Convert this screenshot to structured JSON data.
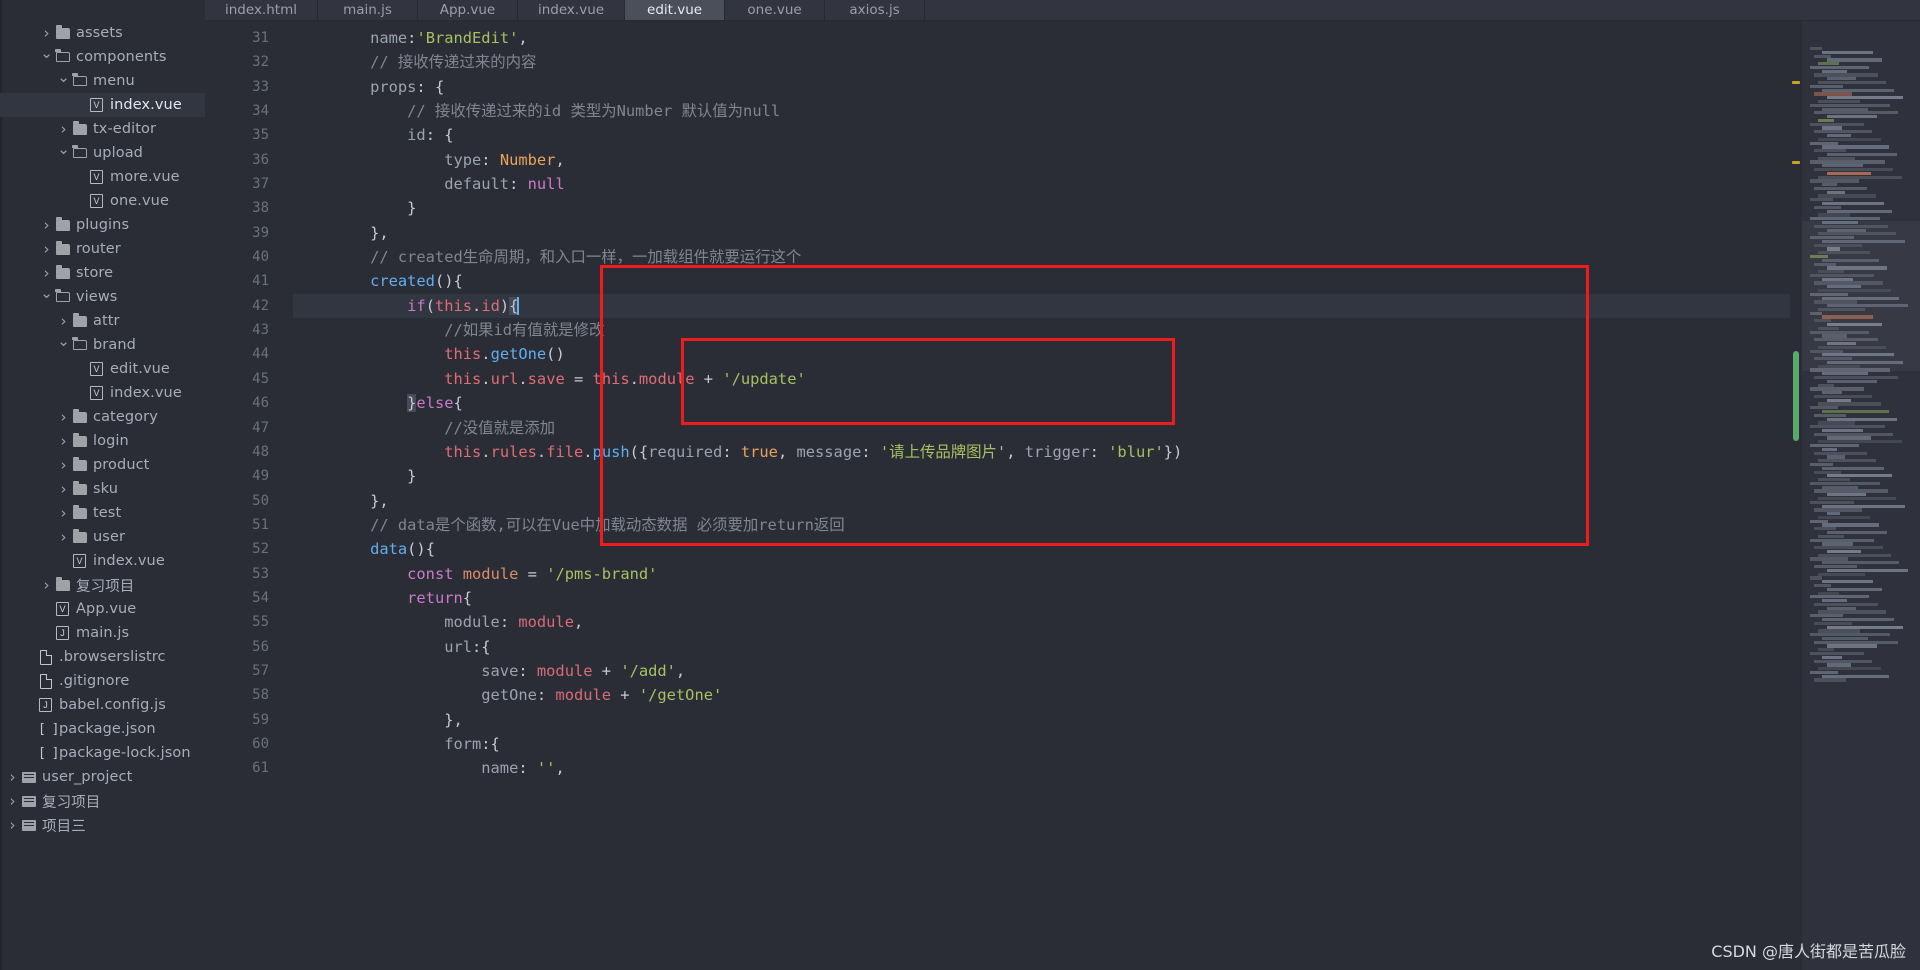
{
  "window": {
    "accent_red": "#f21b1b",
    "background": "#2b2d36",
    "watermark": "CSDN @唐人街都是苦瓜脸"
  },
  "tabs": [
    {
      "label": "index.html",
      "active": false
    },
    {
      "label": "main.js",
      "active": false
    },
    {
      "label": "App.vue",
      "active": false
    },
    {
      "label": "index.vue",
      "active": false
    },
    {
      "label": "edit.vue",
      "active": true
    },
    {
      "label": "one.vue",
      "active": false
    },
    {
      "label": "axios.js",
      "active": false
    }
  ],
  "sidebar": {
    "items": [
      {
        "label": "assets",
        "indent": 2,
        "arrow": "right",
        "icon": "folder-closed-icon",
        "selected": false
      },
      {
        "label": "components",
        "indent": 2,
        "arrow": "down",
        "icon": "folder-open-icon",
        "selected": false
      },
      {
        "label": "menu",
        "indent": 3,
        "arrow": "down",
        "icon": "folder-open-icon",
        "selected": false
      },
      {
        "label": "index.vue",
        "indent": 4,
        "arrow": "none",
        "icon": "vue-file-icon",
        "selected": true
      },
      {
        "label": "tx-editor",
        "indent": 3,
        "arrow": "right",
        "icon": "folder-closed-icon",
        "selected": false
      },
      {
        "label": "upload",
        "indent": 3,
        "arrow": "down",
        "icon": "folder-open-icon",
        "selected": false
      },
      {
        "label": "more.vue",
        "indent": 4,
        "arrow": "none",
        "icon": "vue-file-icon",
        "selected": false
      },
      {
        "label": "one.vue",
        "indent": 4,
        "arrow": "none",
        "icon": "vue-file-icon",
        "selected": false
      },
      {
        "label": "plugins",
        "indent": 2,
        "arrow": "right",
        "icon": "folder-closed-icon",
        "selected": false
      },
      {
        "label": "router",
        "indent": 2,
        "arrow": "right",
        "icon": "folder-closed-icon",
        "selected": false
      },
      {
        "label": "store",
        "indent": 2,
        "arrow": "right",
        "icon": "folder-closed-icon",
        "selected": false
      },
      {
        "label": "views",
        "indent": 2,
        "arrow": "down",
        "icon": "folder-open-icon",
        "selected": false
      },
      {
        "label": "attr",
        "indent": 3,
        "arrow": "right",
        "icon": "folder-closed-icon",
        "selected": false
      },
      {
        "label": "brand",
        "indent": 3,
        "arrow": "down",
        "icon": "folder-open-icon",
        "selected": false
      },
      {
        "label": "edit.vue",
        "indent": 4,
        "arrow": "none",
        "icon": "vue-file-icon",
        "selected": false
      },
      {
        "label": "index.vue",
        "indent": 4,
        "arrow": "none",
        "icon": "vue-file-icon",
        "selected": false
      },
      {
        "label": "category",
        "indent": 3,
        "arrow": "right",
        "icon": "folder-closed-icon",
        "selected": false
      },
      {
        "label": "login",
        "indent": 3,
        "arrow": "right",
        "icon": "folder-closed-icon",
        "selected": false
      },
      {
        "label": "product",
        "indent": 3,
        "arrow": "right",
        "icon": "folder-closed-icon",
        "selected": false
      },
      {
        "label": "sku",
        "indent": 3,
        "arrow": "right",
        "icon": "folder-closed-icon",
        "selected": false
      },
      {
        "label": "test",
        "indent": 3,
        "arrow": "right",
        "icon": "folder-closed-icon",
        "selected": false
      },
      {
        "label": "user",
        "indent": 3,
        "arrow": "right",
        "icon": "folder-closed-icon",
        "selected": false
      },
      {
        "label": "index.vue",
        "indent": 3,
        "arrow": "none",
        "icon": "vue-file-icon",
        "selected": false
      },
      {
        "label": "复习项目",
        "indent": 2,
        "arrow": "right",
        "icon": "folder-closed-icon",
        "selected": false
      },
      {
        "label": "App.vue",
        "indent": 2,
        "arrow": "none",
        "icon": "vue-file-icon",
        "selected": false
      },
      {
        "label": "main.js",
        "indent": 2,
        "arrow": "none",
        "icon": "js-file-icon",
        "selected": false
      },
      {
        "label": ".browserslistrc",
        "indent": 1,
        "arrow": "none",
        "icon": "file-icon",
        "selected": false
      },
      {
        "label": ".gitignore",
        "indent": 1,
        "arrow": "none",
        "icon": "file-icon",
        "selected": false
      },
      {
        "label": "babel.config.js",
        "indent": 1,
        "arrow": "none",
        "icon": "js-file-icon",
        "selected": false
      },
      {
        "label": "package.json",
        "indent": 1,
        "arrow": "none",
        "icon": "json-file-icon",
        "selected": false
      },
      {
        "label": "package-lock.json",
        "indent": 1,
        "arrow": "none",
        "icon": "json-file-icon",
        "selected": false
      },
      {
        "label": "user_project",
        "indent": 0,
        "arrow": "right",
        "icon": "module-icon",
        "selected": false
      },
      {
        "label": "复习项目",
        "indent": 0,
        "arrow": "right",
        "icon": "module-icon",
        "selected": false
      },
      {
        "label": "项目三",
        "indent": 0,
        "arrow": "right",
        "icon": "module-icon",
        "selected": false
      }
    ]
  },
  "editor": {
    "first_line_number": 31,
    "highlighted_line_number": 42,
    "lines": [
      {
        "num": 31,
        "fold": false,
        "tokens": [
          {
            "t": "    ",
            "c": "c-plain"
          },
          {
            "t": "name",
            "c": "c-prop"
          },
          {
            "t": ":",
            "c": "c-op"
          },
          {
            "t": "'BrandEdit'",
            "c": "c-str"
          },
          {
            "t": ",",
            "c": "c-op"
          }
        ]
      },
      {
        "num": 32,
        "fold": false,
        "tokens": [
          {
            "t": "    // 接收传递过来的内容",
            "c": "c-com"
          }
        ]
      },
      {
        "num": 33,
        "fold": true,
        "tokens": [
          {
            "t": "    ",
            "c": "c-plain"
          },
          {
            "t": "props",
            "c": "c-prop"
          },
          {
            "t": ": {",
            "c": "c-op"
          }
        ]
      },
      {
        "num": 34,
        "fold": false,
        "tokens": [
          {
            "t": "        // 接收传递过来的id 类型为Number 默认值为null",
            "c": "c-com"
          }
        ]
      },
      {
        "num": 35,
        "fold": true,
        "tokens": [
          {
            "t": "        ",
            "c": "c-plain"
          },
          {
            "t": "id",
            "c": "c-prop"
          },
          {
            "t": ": {",
            "c": "c-op"
          }
        ]
      },
      {
        "num": 36,
        "fold": false,
        "tokens": [
          {
            "t": "            ",
            "c": "c-plain"
          },
          {
            "t": "type",
            "c": "c-prop"
          },
          {
            "t": ": ",
            "c": "c-op"
          },
          {
            "t": "Number",
            "c": "c-type"
          },
          {
            "t": ",",
            "c": "c-op"
          }
        ]
      },
      {
        "num": 37,
        "fold": false,
        "tokens": [
          {
            "t": "            ",
            "c": "c-plain"
          },
          {
            "t": "default",
            "c": "c-prop"
          },
          {
            "t": ": ",
            "c": "c-op"
          },
          {
            "t": "null",
            "c": "c-key"
          }
        ]
      },
      {
        "num": 38,
        "fold": false,
        "tokens": [
          {
            "t": "        }",
            "c": "c-op"
          }
        ]
      },
      {
        "num": 39,
        "fold": false,
        "tokens": [
          {
            "t": "    },",
            "c": "c-op"
          }
        ]
      },
      {
        "num": 40,
        "fold": false,
        "tokens": [
          {
            "t": "    // created生命周期，和入口一样，一加载组件就要运行这个",
            "c": "c-com"
          }
        ]
      },
      {
        "num": 41,
        "fold": true,
        "tokens": [
          {
            "t": "    ",
            "c": "c-plain"
          },
          {
            "t": "created",
            "c": "c-fn"
          },
          {
            "t": "(){",
            "c": "c-op"
          }
        ]
      },
      {
        "num": 42,
        "fold": true,
        "highlight": true,
        "tokens": [
          {
            "t": "        ",
            "c": "c-plain"
          },
          {
            "t": "if",
            "c": "c-key"
          },
          {
            "t": "(",
            "c": "c-op"
          },
          {
            "t": "this",
            "c": "c-this"
          },
          {
            "t": ".",
            "c": "c-op"
          },
          {
            "t": "id",
            "c": "c-this"
          },
          {
            "t": ")",
            "c": "c-op"
          },
          {
            "t": "{",
            "c": "c-op brace-hl"
          }
        ],
        "caret": true
      },
      {
        "num": 43,
        "fold": false,
        "tokens": [
          {
            "t": "            //如果id有值就是修改",
            "c": "c-com"
          }
        ]
      },
      {
        "num": 44,
        "fold": false,
        "tokens": [
          {
            "t": "            ",
            "c": "c-plain"
          },
          {
            "t": "this",
            "c": "c-this"
          },
          {
            "t": ".",
            "c": "c-op"
          },
          {
            "t": "getOne",
            "c": "c-fn"
          },
          {
            "t": "()",
            "c": "c-op"
          }
        ]
      },
      {
        "num": 45,
        "fold": false,
        "tokens": [
          {
            "t": "            ",
            "c": "c-plain"
          },
          {
            "t": "this",
            "c": "c-this"
          },
          {
            "t": ".",
            "c": "c-op"
          },
          {
            "t": "url",
            "c": "c-this"
          },
          {
            "t": ".",
            "c": "c-op"
          },
          {
            "t": "save",
            "c": "c-this"
          },
          {
            "t": " = ",
            "c": "c-op"
          },
          {
            "t": "this",
            "c": "c-this"
          },
          {
            "t": ".",
            "c": "c-op"
          },
          {
            "t": "module",
            "c": "c-this"
          },
          {
            "t": " + ",
            "c": "c-op"
          },
          {
            "t": "'/update'",
            "c": "c-str"
          }
        ]
      },
      {
        "num": 46,
        "fold": true,
        "tokens": [
          {
            "t": "        ",
            "c": "c-plain"
          },
          {
            "t": "}",
            "c": "c-op brace-hl"
          },
          {
            "t": "else",
            "c": "c-key"
          },
          {
            "t": "{",
            "c": "c-op"
          }
        ]
      },
      {
        "num": 47,
        "fold": false,
        "tokens": [
          {
            "t": "            //没值就是添加",
            "c": "c-com"
          }
        ]
      },
      {
        "num": 48,
        "fold": false,
        "tokens": [
          {
            "t": "            ",
            "c": "c-plain"
          },
          {
            "t": "this",
            "c": "c-this"
          },
          {
            "t": ".",
            "c": "c-op"
          },
          {
            "t": "rules",
            "c": "c-this"
          },
          {
            "t": ".",
            "c": "c-op"
          },
          {
            "t": "file",
            "c": "c-this"
          },
          {
            "t": ".",
            "c": "c-op"
          },
          {
            "t": "push",
            "c": "c-fn"
          },
          {
            "t": "({",
            "c": "c-op"
          },
          {
            "t": "required",
            "c": "c-prop"
          },
          {
            "t": ": ",
            "c": "c-op"
          },
          {
            "t": "true",
            "c": "c-bool"
          },
          {
            "t": ", ",
            "c": "c-op"
          },
          {
            "t": "message",
            "c": "c-prop"
          },
          {
            "t": ": ",
            "c": "c-op"
          },
          {
            "t": "'请上传品牌图片'",
            "c": "c-str"
          },
          {
            "t": ", ",
            "c": "c-op"
          },
          {
            "t": "trigger",
            "c": "c-prop"
          },
          {
            "t": ": ",
            "c": "c-op"
          },
          {
            "t": "'blur'",
            "c": "c-str"
          },
          {
            "t": "})",
            "c": "c-op"
          }
        ]
      },
      {
        "num": 49,
        "fold": false,
        "tokens": [
          {
            "t": "        }",
            "c": "c-op"
          }
        ]
      },
      {
        "num": 50,
        "fold": false,
        "tokens": [
          {
            "t": "    },",
            "c": "c-op"
          }
        ]
      },
      {
        "num": 51,
        "fold": false,
        "tokens": [
          {
            "t": "    // data是个函数,可以在Vue中加载动态数据 必须要加return返回",
            "c": "c-com"
          }
        ]
      },
      {
        "num": 52,
        "fold": true,
        "tokens": [
          {
            "t": "    ",
            "c": "c-plain"
          },
          {
            "t": "data",
            "c": "c-fn"
          },
          {
            "t": "(){",
            "c": "c-op"
          }
        ]
      },
      {
        "num": 53,
        "fold": false,
        "tokens": [
          {
            "t": "        ",
            "c": "c-plain"
          },
          {
            "t": "const",
            "c": "c-key"
          },
          {
            "t": " ",
            "c": "c-op"
          },
          {
            "t": "module",
            "c": "c-var"
          },
          {
            "t": " = ",
            "c": "c-op"
          },
          {
            "t": "'/pms-brand'",
            "c": "c-str"
          }
        ]
      },
      {
        "num": 54,
        "fold": true,
        "tokens": [
          {
            "t": "        ",
            "c": "c-plain"
          },
          {
            "t": "return",
            "c": "c-key"
          },
          {
            "t": "{",
            "c": "c-op"
          }
        ]
      },
      {
        "num": 55,
        "fold": false,
        "tokens": [
          {
            "t": "            ",
            "c": "c-plain"
          },
          {
            "t": "module",
            "c": "c-prop"
          },
          {
            "t": ": ",
            "c": "c-op"
          },
          {
            "t": "module",
            "c": "c-ident"
          },
          {
            "t": ",",
            "c": "c-op"
          }
        ]
      },
      {
        "num": 56,
        "fold": true,
        "tokens": [
          {
            "t": "            ",
            "c": "c-plain"
          },
          {
            "t": "url",
            "c": "c-prop"
          },
          {
            "t": ":{",
            "c": "c-op"
          }
        ]
      },
      {
        "num": 57,
        "fold": false,
        "tokens": [
          {
            "t": "                ",
            "c": "c-plain"
          },
          {
            "t": "save",
            "c": "c-prop"
          },
          {
            "t": ": ",
            "c": "c-op"
          },
          {
            "t": "module",
            "c": "c-ident"
          },
          {
            "t": " + ",
            "c": "c-op"
          },
          {
            "t": "'/add'",
            "c": "c-str"
          },
          {
            "t": ",",
            "c": "c-op"
          }
        ]
      },
      {
        "num": 58,
        "fold": false,
        "tokens": [
          {
            "t": "                ",
            "c": "c-plain"
          },
          {
            "t": "getOne",
            "c": "c-prop"
          },
          {
            "t": ": ",
            "c": "c-op"
          },
          {
            "t": "module",
            "c": "c-ident"
          },
          {
            "t": " + ",
            "c": "c-op"
          },
          {
            "t": "'/getOne'",
            "c": "c-str"
          }
        ]
      },
      {
        "num": 59,
        "fold": false,
        "tokens": [
          {
            "t": "            },",
            "c": "c-op"
          }
        ]
      },
      {
        "num": 60,
        "fold": true,
        "tokens": [
          {
            "t": "            ",
            "c": "c-plain"
          },
          {
            "t": "form",
            "c": "c-prop"
          },
          {
            "t": ":{",
            "c": "c-op"
          }
        ]
      },
      {
        "num": 61,
        "fold": false,
        "tokens": [
          {
            "t": "                ",
            "c": "c-plain"
          },
          {
            "t": "name",
            "c": "c-prop"
          },
          {
            "t": ": ",
            "c": "c-op"
          },
          {
            "t": "''",
            "c": "c-str"
          },
          {
            "t": ",",
            "c": "c-op"
          }
        ]
      }
    ],
    "annotations": [
      {
        "name": "outer-red-box",
        "wraps": "created-lifecycle-block"
      },
      {
        "name": "inner-red-box",
        "wraps": "if-this-id-body"
      }
    ]
  }
}
